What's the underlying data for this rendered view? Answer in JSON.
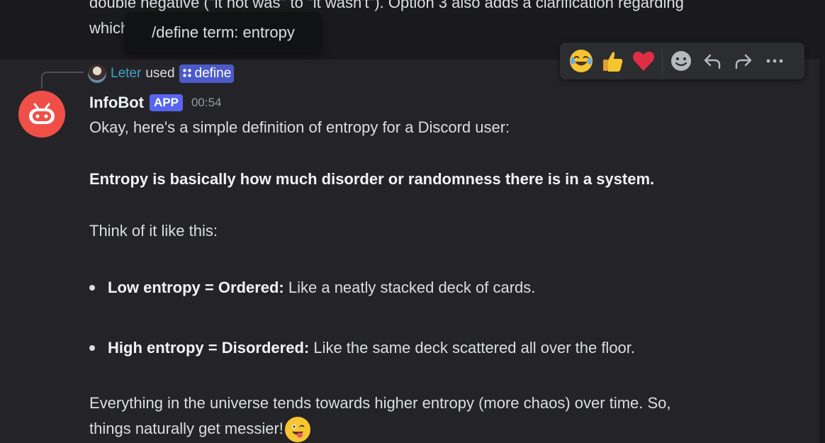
{
  "previous_message": {
    "line1": "double negative (\"it not was\" to \"it wasn't\"). Option 3 also adds a clarification regarding",
    "line2": "which"
  },
  "tooltip": {
    "text": "/define term: entropy"
  },
  "reply": {
    "user": "Leter",
    "used": "used",
    "command": "define"
  },
  "message": {
    "author": "InfoBot",
    "badge": "APP",
    "timestamp": "00:54",
    "intro": "Okay, here's a simple definition of entropy for a Discord user:",
    "bold_statement": "Entropy is basically how much disorder or randomness there is in a system.",
    "think": "Think of it like this:",
    "bullets": [
      {
        "label": "Low entropy = Ordered:",
        "text": " Like a neatly stacked deck of cards."
      },
      {
        "label": "High entropy = Disordered:",
        "text": " Like the same deck scattered all over the floor."
      }
    ],
    "conclusion_line1": "Everything in the universe tends towards higher entropy (more chaos) over time. So,",
    "conclusion_line2": "things naturally get messier!"
  },
  "toolbar_icons": [
    "joy-emoji-icon",
    "thumbs-up-emoji-icon",
    "heart-emoji-icon",
    "add-reaction-icon",
    "reply-icon",
    "forward-icon",
    "more-icon"
  ],
  "colors": {
    "accent": "#5865f2",
    "avatar_bg": "#f04f48",
    "username_link": "#3ea3c9",
    "background": "#1a1a1e",
    "hover_background": "#242428"
  }
}
